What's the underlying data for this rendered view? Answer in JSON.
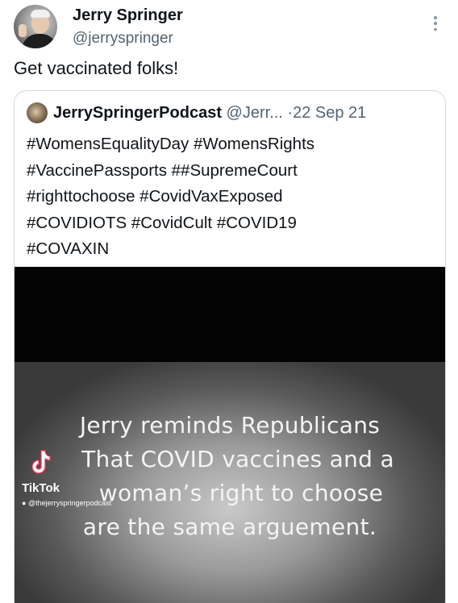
{
  "author": {
    "name": "Jerry Springer",
    "handle": "@jerryspringer"
  },
  "tweet": {
    "text": "Get vaccinated folks!"
  },
  "quote": {
    "name": "JerrySpringerPodcast",
    "handle": "@Jerr...",
    "separator": "·",
    "date": "22 Sep 21",
    "lines": [
      "#WomensEqualityDay #WomensRights",
      "#VaccinePassports ##SupremeCourt",
      "#righttochoose #CovidVaxExposed",
      "#COVIDIOTS #CovidCult #COVID19",
      "#COVAXIN"
    ]
  },
  "video": {
    "caption_lines": [
      "Jerry reminds Republicans",
      "That COVID vaccines and a",
      "woman’s right to choose",
      "are the same arguement."
    ],
    "tiktok_label": "TikTok",
    "tiktok_user": "@thejerryspringerpodcast"
  },
  "icons": {
    "more": "more-vertical-icon",
    "tiktok": "tiktok-logo-icon",
    "user": "user-icon"
  }
}
